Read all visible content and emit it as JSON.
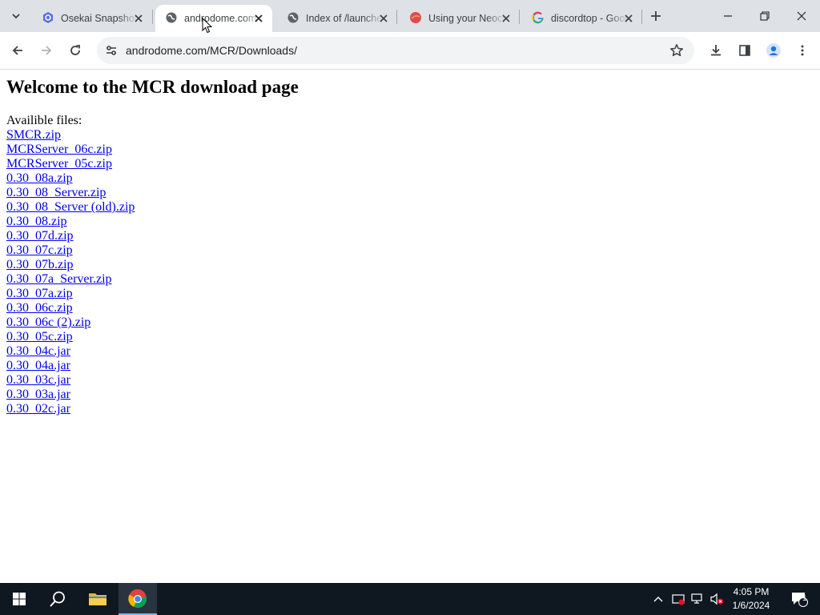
{
  "tabs": [
    {
      "title": "Osekai Snapshots",
      "favicon": "osekai-icon"
    },
    {
      "title": "androdome.com",
      "favicon": "globe-icon",
      "active": true
    },
    {
      "title": "Index of /launcher",
      "favicon": "globe-icon"
    },
    {
      "title": "Using your Neocities",
      "favicon": "neocities-icon"
    },
    {
      "title": "discordtop - Google",
      "favicon": "google-icon"
    }
  ],
  "address_bar": {
    "url": "androdome.com/MCR/Downloads/"
  },
  "page": {
    "heading": "Welcome to the MCR download page",
    "lead": "Availible files:",
    "files": [
      "SMCR.zip",
      "MCRServer_06c.zip",
      "MCRServer_05c.zip",
      "0.30_08a.zip",
      "0.30_08_Server.zip",
      "0.30_08_Server (old).zip",
      "0.30_08.zip",
      "0.30_07d.zip",
      "0.30_07c.zip",
      "0.30_07b.zip",
      "0.30_07a_Server.zip",
      "0.30_07a.zip",
      "0.30_06c.zip",
      "0.30_06c (2).zip",
      "0.30_05c.zip",
      "0.30_04c.jar",
      "0.30_04a.jar",
      "0.30_03c.jar",
      "0.30_03a.jar",
      "0.30_02c.jar"
    ]
  },
  "taskbar": {
    "time": "4:05 PM",
    "date": "1/6/2024",
    "notification_count": "1"
  },
  "colors": {
    "link": "#0000ee",
    "tabstrip": "#dee1e6",
    "taskbar": "#0f1720"
  }
}
